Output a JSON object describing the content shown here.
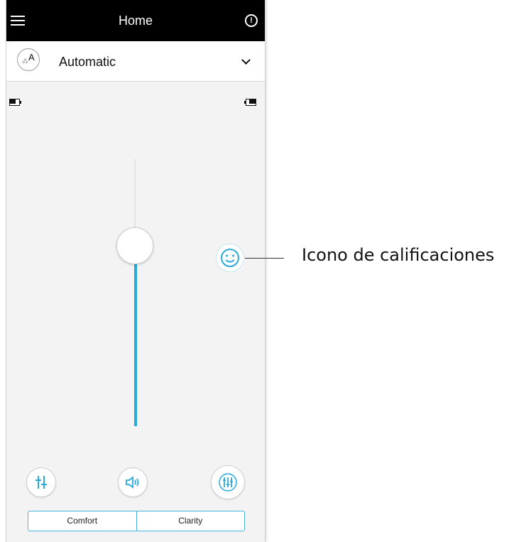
{
  "header": {
    "title": "Home",
    "menu_icon": "hamburger-menu-icon",
    "alert_icon": "alert-circle-icon",
    "alert_glyph": "!"
  },
  "program": {
    "name": "Automatic",
    "icon": "automatic-program-icon",
    "icon_letter": "A",
    "dropdown_icon": "chevron-down-icon"
  },
  "batteries": {
    "left_icon": "battery-icon",
    "right_icon": "battery-icon"
  },
  "volume_slider": {
    "level": 0.66
  },
  "rating": {
    "icon": "smiley-face-icon"
  },
  "bottom_controls": {
    "equalizer_icon": "equalizer-icon",
    "volume_icon": "speaker-icon",
    "tuning_icon": "sliders-icon"
  },
  "modes": [
    {
      "label": "Comfort"
    },
    {
      "label": "Clarity"
    }
  ],
  "callout": {
    "label": "Icono de calificaciones"
  },
  "colors": {
    "accent": "#29a9d8",
    "header_bg": "#000000",
    "screen_bg": "#f3f3f3"
  }
}
